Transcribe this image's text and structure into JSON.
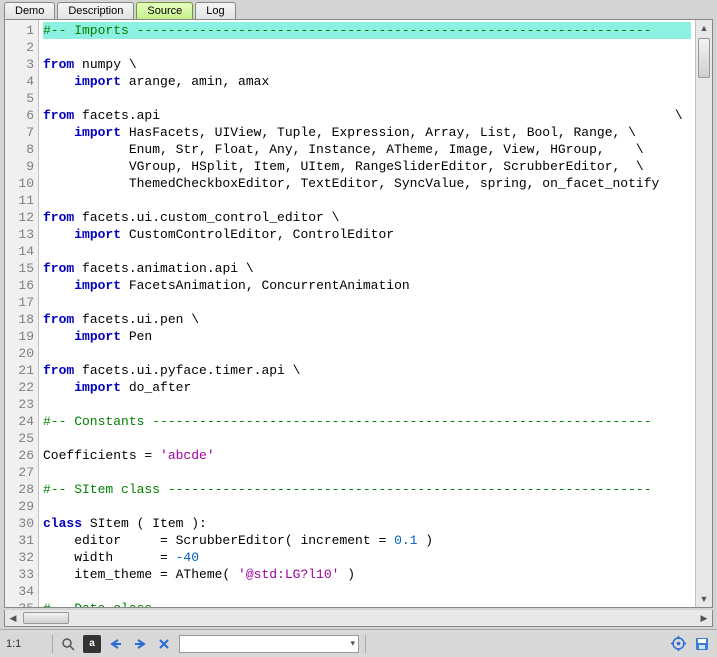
{
  "tabs": [
    {
      "label": "Demo",
      "active": false
    },
    {
      "label": "Description",
      "active": false
    },
    {
      "label": "Source",
      "active": true
    },
    {
      "label": "Log",
      "active": false
    }
  ],
  "status": {
    "position": "1:1",
    "search_value": ""
  },
  "code": {
    "lines": [
      {
        "type": "comment",
        "text": "#-- Imports ------------------------------------------------------------------"
      },
      {
        "type": "blank",
        "text": ""
      },
      {
        "type": "kw_ident",
        "kw": "from",
        "ident": " numpy \\"
      },
      {
        "type": "import_list",
        "indent": "    ",
        "kw": "import",
        "rest": " arange, amin, amax"
      },
      {
        "type": "blank",
        "text": ""
      },
      {
        "type": "kw_ident",
        "kw": "from",
        "ident": " facets.api                                                                  \\"
      },
      {
        "type": "import_list",
        "indent": "    ",
        "kw": "import",
        "rest": " HasFacets, UIView, Tuple, Expression, Array, List, Bool, Range, \\"
      },
      {
        "type": "cont",
        "indent": "           ",
        "rest": "Enum, Str, Float, Any, Instance, ATheme, Image, View, HGroup,    \\"
      },
      {
        "type": "cont",
        "indent": "           ",
        "rest": "VGroup, HSplit, Item, UItem, RangeSliderEditor, ScrubberEditor,  \\"
      },
      {
        "type": "cont",
        "indent": "           ",
        "rest": "ThemedCheckboxEditor, TextEditor, SyncValue, spring, on_facet_notify"
      },
      {
        "type": "blank",
        "text": ""
      },
      {
        "type": "kw_ident",
        "kw": "from",
        "ident": " facets.ui.custom_control_editor \\"
      },
      {
        "type": "import_list",
        "indent": "    ",
        "kw": "import",
        "rest": " CustomControlEditor, ControlEditor"
      },
      {
        "type": "blank",
        "text": ""
      },
      {
        "type": "kw_ident",
        "kw": "from",
        "ident": " facets.animation.api \\"
      },
      {
        "type": "import_list",
        "indent": "    ",
        "kw": "import",
        "rest": " FacetsAnimation, ConcurrentAnimation"
      },
      {
        "type": "blank",
        "text": ""
      },
      {
        "type": "kw_ident",
        "kw": "from",
        "ident": " facets.ui.pen \\"
      },
      {
        "type": "import_list",
        "indent": "    ",
        "kw": "import",
        "rest": " Pen"
      },
      {
        "type": "blank",
        "text": ""
      },
      {
        "type": "kw_ident",
        "kw": "from",
        "ident": " facets.ui.pyface.timer.api \\"
      },
      {
        "type": "import_list",
        "indent": "    ",
        "kw": "import",
        "rest": " do_after"
      },
      {
        "type": "blank",
        "text": ""
      },
      {
        "type": "comment",
        "text": "#-- Constants ----------------------------------------------------------------"
      },
      {
        "type": "blank",
        "text": ""
      },
      {
        "type": "assign_str",
        "lhs": "Coefficients = ",
        "str": "'abcde'"
      },
      {
        "type": "blank",
        "text": ""
      },
      {
        "type": "comment",
        "text": "#-- SItem class --------------------------------------------------------------"
      },
      {
        "type": "blank",
        "text": ""
      },
      {
        "type": "classdef",
        "kw": "class",
        "rest": " SItem ( Item ):"
      },
      {
        "type": "attr_call",
        "indent": "    ",
        "lhs": "editor     = ",
        "call": "ScrubberEditor( increment = ",
        "num": "0.1",
        "tail": " )"
      },
      {
        "type": "attr_num",
        "indent": "    ",
        "lhs": "width      = ",
        "num": "-40"
      },
      {
        "type": "attr_callstr",
        "indent": "    ",
        "lhs": "item_theme = ",
        "call": "ATheme( ",
        "str": "'@std:LG?l10'",
        "tail": " )"
      },
      {
        "type": "blank",
        "text": ""
      },
      {
        "type": "comment",
        "text": "#-- Data class ---------------------------------------------------------------"
      },
      {
        "type": "blank",
        "text": ""
      }
    ]
  },
  "colors": {
    "highlight": "#8ef0e0",
    "keyword": "#0000c0",
    "comment": "#008000",
    "string": "#a000a0",
    "number": "#0060c0"
  }
}
